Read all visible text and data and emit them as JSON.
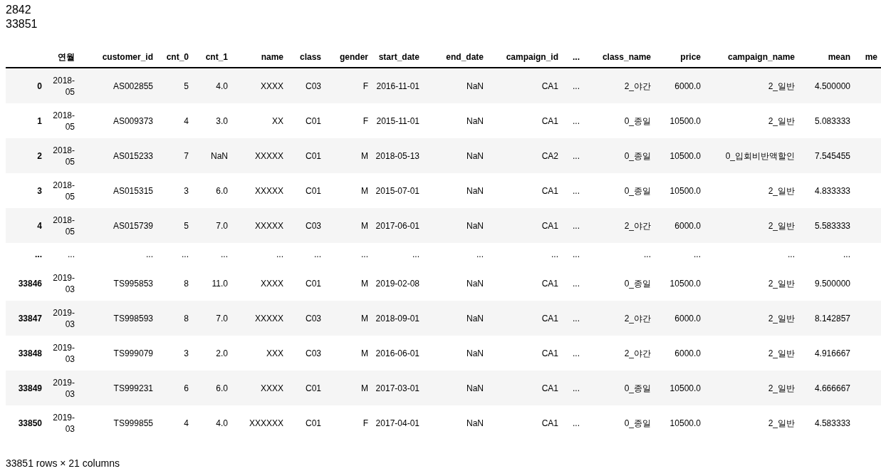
{
  "output_lines": [
    "2842",
    "33851"
  ],
  "table": {
    "columns": [
      "",
      "연월",
      "customer_id",
      "cnt_0",
      "cnt_1",
      "name",
      "class",
      "gender",
      "start_date",
      "end_date",
      "campaign_id",
      "...",
      "class_name",
      "price",
      "campaign_name",
      "mean",
      "me"
    ],
    "rows": [
      {
        "kind": "data",
        "cells": [
          "0",
          "2018-05",
          "AS002855",
          "5",
          "4.0",
          "XXXX",
          "C03",
          "F",
          "2016-11-01",
          "NaN",
          "CA1",
          "...",
          "2_야간",
          "6000.0",
          "2_일반",
          "4.500000",
          ""
        ]
      },
      {
        "kind": "data",
        "cells": [
          "1",
          "2018-05",
          "AS009373",
          "4",
          "3.0",
          "XX",
          "C01",
          "F",
          "2015-11-01",
          "NaN",
          "CA1",
          "...",
          "0_종일",
          "10500.0",
          "2_일반",
          "5.083333",
          ""
        ]
      },
      {
        "kind": "data",
        "cells": [
          "2",
          "2018-05",
          "AS015233",
          "7",
          "NaN",
          "XXXXX",
          "C01",
          "M",
          "2018-05-13",
          "NaN",
          "CA2",
          "...",
          "0_종일",
          "10500.0",
          "0_입회비반액할인",
          "7.545455",
          ""
        ]
      },
      {
        "kind": "data",
        "cells": [
          "3",
          "2018-05",
          "AS015315",
          "3",
          "6.0",
          "XXXXX",
          "C01",
          "M",
          "2015-07-01",
          "NaN",
          "CA1",
          "...",
          "0_종일",
          "10500.0",
          "2_일반",
          "4.833333",
          ""
        ]
      },
      {
        "kind": "data",
        "cells": [
          "4",
          "2018-05",
          "AS015739",
          "5",
          "7.0",
          "XXXXX",
          "C03",
          "M",
          "2017-06-01",
          "NaN",
          "CA1",
          "...",
          "2_야간",
          "6000.0",
          "2_일반",
          "5.583333",
          ""
        ]
      },
      {
        "kind": "ellipsis",
        "cells": [
          "...",
          "...",
          "...",
          "...",
          "...",
          "...",
          "...",
          "...",
          "...",
          "...",
          "...",
          "...",
          "...",
          "...",
          "...",
          "...",
          ""
        ]
      },
      {
        "kind": "data",
        "cells": [
          "33846",
          "2019-03",
          "TS995853",
          "8",
          "11.0",
          "XXXX",
          "C01",
          "M",
          "2019-02-08",
          "NaN",
          "CA1",
          "...",
          "0_종일",
          "10500.0",
          "2_일반",
          "9.500000",
          ""
        ]
      },
      {
        "kind": "data",
        "cells": [
          "33847",
          "2019-03",
          "TS998593",
          "8",
          "7.0",
          "XXXXX",
          "C03",
          "M",
          "2018-09-01",
          "NaN",
          "CA1",
          "...",
          "2_야간",
          "6000.0",
          "2_일반",
          "8.142857",
          ""
        ]
      },
      {
        "kind": "data",
        "cells": [
          "33848",
          "2019-03",
          "TS999079",
          "3",
          "2.0",
          "XXX",
          "C03",
          "M",
          "2016-06-01",
          "NaN",
          "CA1",
          "...",
          "2_야간",
          "6000.0",
          "2_일반",
          "4.916667",
          ""
        ]
      },
      {
        "kind": "data",
        "cells": [
          "33849",
          "2019-03",
          "TS999231",
          "6",
          "6.0",
          "XXXX",
          "C01",
          "M",
          "2017-03-01",
          "NaN",
          "CA1",
          "...",
          "0_종일",
          "10500.0",
          "2_일반",
          "4.666667",
          ""
        ]
      },
      {
        "kind": "data",
        "cells": [
          "33850",
          "2019-03",
          "TS999855",
          "4",
          "4.0",
          "XXXXXX",
          "C01",
          "F",
          "2017-04-01",
          "NaN",
          "CA1",
          "...",
          "0_종일",
          "10500.0",
          "2_일반",
          "4.583333",
          ""
        ]
      }
    ]
  },
  "footer": "33851 rows × 21 columns"
}
